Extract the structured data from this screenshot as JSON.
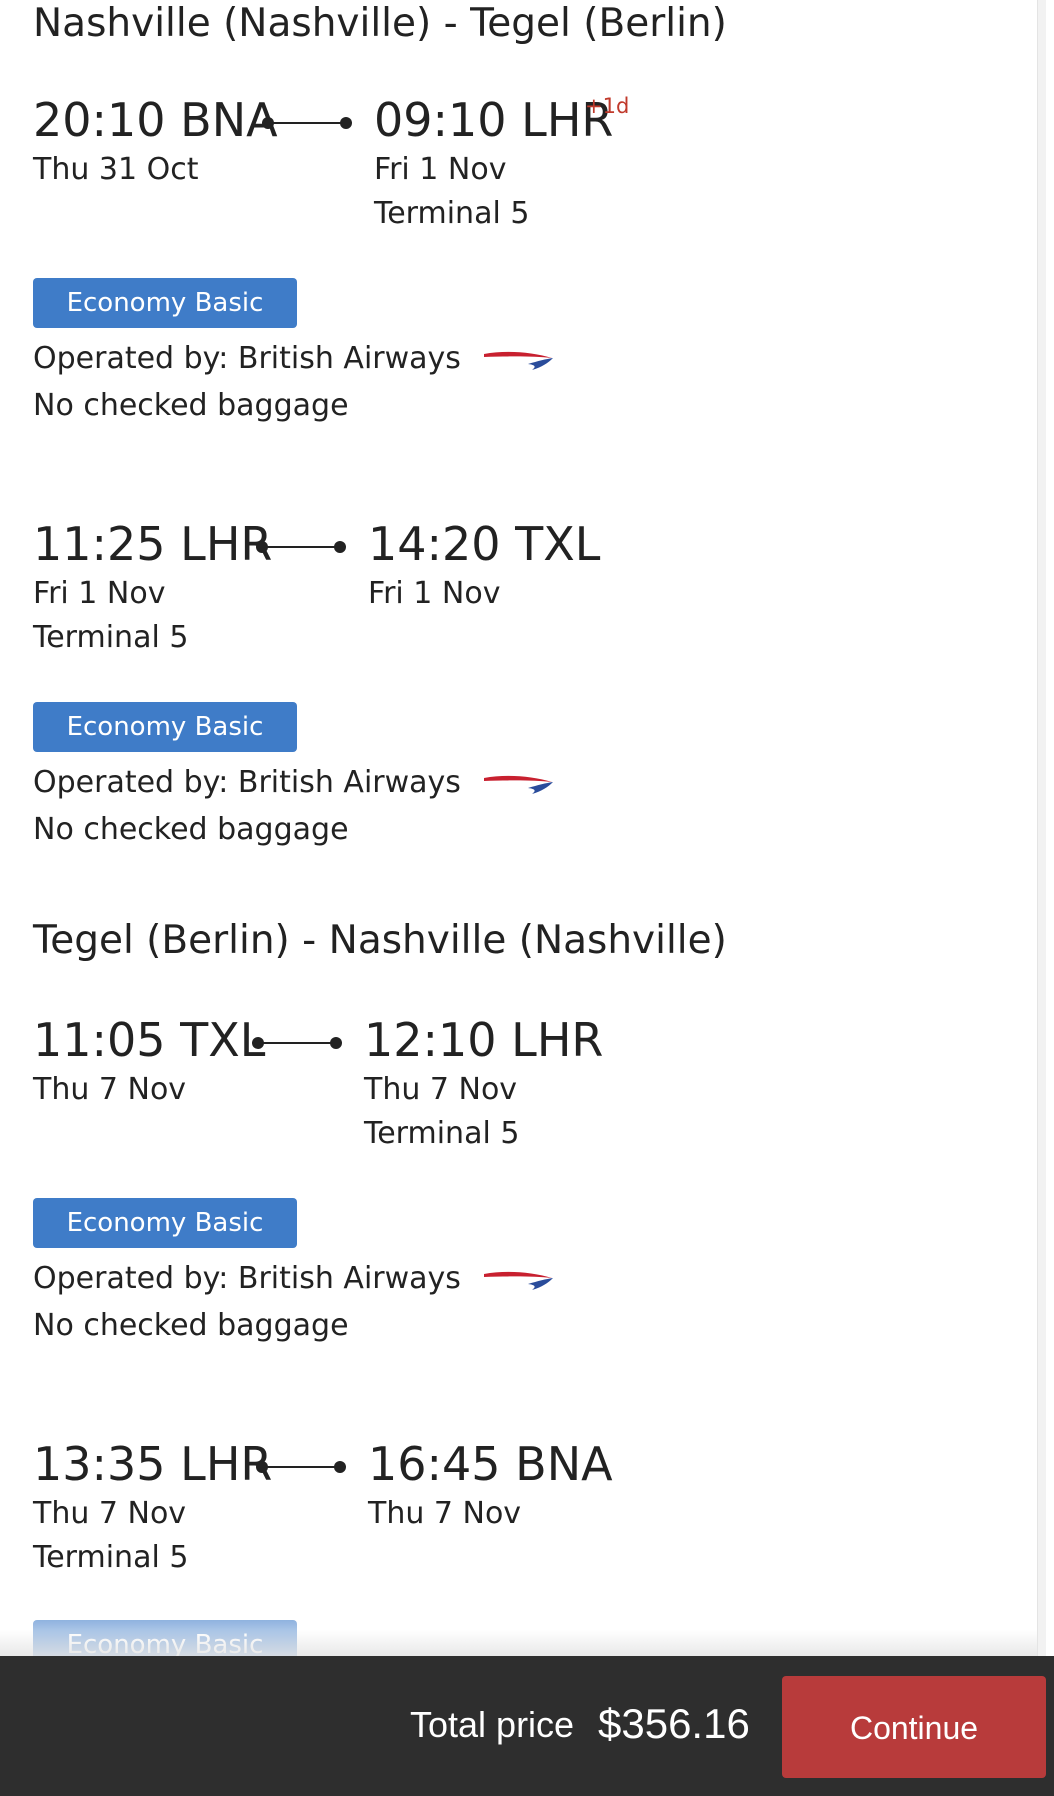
{
  "routes": [
    {
      "header": "Nashville (Nashville) - Tegel (Berlin)",
      "segments": [
        {
          "dep_time": "20:10 BNA",
          "dep_date": "Thu 31 Oct",
          "dep_terminal": "",
          "arr_time": "09:10 LHR",
          "arr_plus_day": "+1d",
          "arr_date": "Fri 1 Nov",
          "arr_terminal": "Terminal 5",
          "fare_class": "Economy Basic",
          "operated_by": "Operated by: British Airways",
          "airline_logo_icon": "british-airways-logo-icon",
          "baggage": "No checked baggage"
        },
        {
          "dep_time": "11:25 LHR",
          "dep_date": "Fri 1 Nov",
          "dep_terminal": "Terminal 5",
          "arr_time": "14:20 TXL",
          "arr_plus_day": "",
          "arr_date": "Fri 1 Nov",
          "arr_terminal": "",
          "fare_class": "Economy Basic",
          "operated_by": "Operated by: British Airways",
          "airline_logo_icon": "british-airways-logo-icon",
          "baggage": "No checked baggage"
        }
      ]
    },
    {
      "header": "Tegel (Berlin) - Nashville (Nashville)",
      "segments": [
        {
          "dep_time": "11:05 TXL",
          "dep_date": "Thu 7 Nov",
          "dep_terminal": "",
          "arr_time": "12:10 LHR",
          "arr_plus_day": "",
          "arr_date": "Thu 7 Nov",
          "arr_terminal": "Terminal 5",
          "fare_class": "Economy Basic",
          "operated_by": "Operated by: British Airways",
          "airline_logo_icon": "british-airways-logo-icon",
          "baggage": "No checked baggage"
        },
        {
          "dep_time": "13:35 LHR",
          "dep_date": "Thu 7 Nov",
          "dep_terminal": "Terminal 5",
          "arr_time": "16:45 BNA",
          "arr_plus_day": "",
          "arr_date": "Thu 7 Nov",
          "arr_terminal": "",
          "fare_class": "Economy Basic",
          "operated_by": "",
          "airline_logo_icon": "",
          "baggage": ""
        }
      ]
    }
  ],
  "footer": {
    "total_label": "Total price",
    "total_value": "$356.16",
    "continue_label": "Continue"
  },
  "colors": {
    "fare_badge": "#3f7cc8",
    "plus_day": "#c0392b",
    "continue_button": "#b83b3b",
    "footer_bg": "#2e2e2e"
  }
}
